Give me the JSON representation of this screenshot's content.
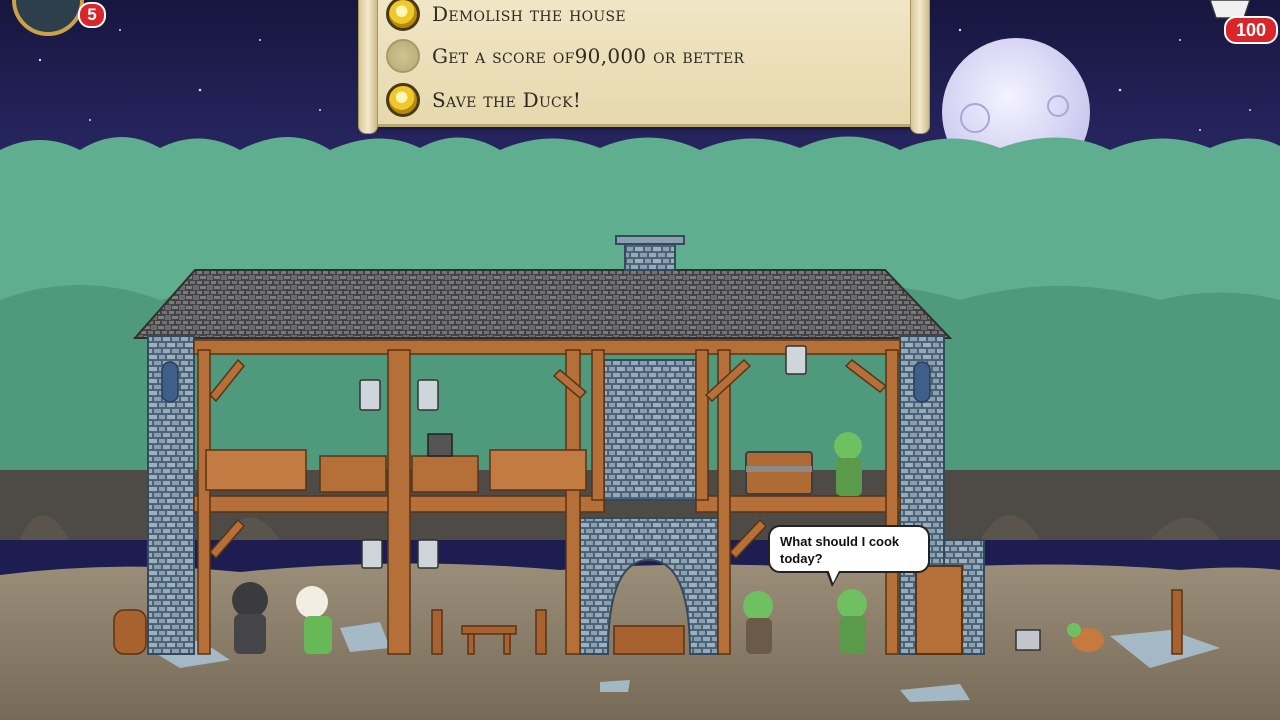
{
  "hud": {
    "level_count": "5",
    "score_remaining": "100"
  },
  "objectives": [
    {
      "label": "Demolish the house",
      "completed": true
    },
    {
      "label": "Get a score of90,000 or better",
      "completed": false
    },
    {
      "label": "Save the Duck!",
      "completed": true
    }
  ],
  "dialogue": {
    "speech_line1": "What should I cook",
    "speech_line2": "today?"
  },
  "colors": {
    "night_sky": "#1e1d52",
    "foliage": "#5aa98a",
    "stone": "#7c93a6",
    "timber": "#b5703a",
    "roof": "#5b5b5b",
    "ground": "#8a7d6a",
    "badge_red": "#d8262a"
  }
}
